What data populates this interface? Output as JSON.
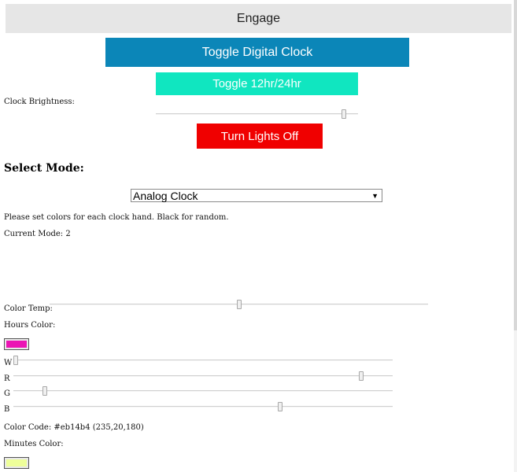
{
  "buttons": {
    "engage": "Engage",
    "toggle_digital": "Toggle Digital Clock",
    "toggle_12_24": "Toggle 12hr/24hr",
    "lights_off": "Turn Lights Off"
  },
  "colors": {
    "engage_bg": "#e6e6e6",
    "digital_bg": "#0b86b8",
    "toggle_bg": "#10e6c0",
    "lights_bg": "#f00000"
  },
  "brightness": {
    "label": "Clock Brightness:",
    "value_fraction": 0.94
  },
  "mode": {
    "heading": "Select Mode:",
    "selected": "Analog Clock",
    "hint": "Please set colors for each clock hand. Black for random.",
    "current": "Current Mode: 2"
  },
  "color_temp": {
    "label": "Color Temp:",
    "value_fraction": 0.5
  },
  "hours": {
    "label": "Hours Color:",
    "swatch_color": "#eb14b4",
    "w_label": "W",
    "r_label": "R",
    "g_label": "G",
    "b_label": "B",
    "w_value": 0,
    "r_value": 235,
    "g_value": 20,
    "b_value": 180,
    "color_code": "Color Code: #eb14b4 (235,20,180)"
  },
  "minutes": {
    "label": "Minutes Color:",
    "swatch_color": "#eeff99"
  }
}
